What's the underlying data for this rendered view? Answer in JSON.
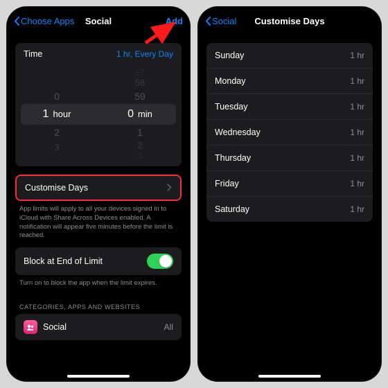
{
  "left": {
    "nav_back": "Choose Apps",
    "nav_title": "Social",
    "nav_add": "Add",
    "time_label": "Time",
    "time_value": "1 hr, Every Day",
    "picker": {
      "hours_above2": "",
      "hours_above": "0",
      "hours_sel": "1",
      "hours_unit": "hour",
      "hours_below": "2",
      "hours_below2": "3",
      "mins_top2": "57",
      "mins_top1": "58",
      "mins_above": "59",
      "mins_sel": "0",
      "mins_unit": "min",
      "mins_below": "1",
      "mins_below2": "2",
      "mins_below3": "3"
    },
    "customise_label": "Customise Days",
    "footnote": "App limits will apply to all your devices signed in to iCloud with Share Across Devices enabled. A notification will appear five minutes before the limit is reached.",
    "block_label": "Block at End of Limit",
    "block_caption": "Turn on to block the app when the limit expires.",
    "section_header": "CATEGORIES, APPS AND WEBSITES",
    "category_name": "Social",
    "category_scope": "All"
  },
  "right": {
    "nav_back": "Social",
    "nav_title": "Customise Days",
    "days": [
      {
        "name": "Sunday",
        "value": "1 hr"
      },
      {
        "name": "Monday",
        "value": "1 hr"
      },
      {
        "name": "Tuesday",
        "value": "1 hr"
      },
      {
        "name": "Wednesday",
        "value": "1 hr"
      },
      {
        "name": "Thursday",
        "value": "1 hr"
      },
      {
        "name": "Friday",
        "value": "1 hr"
      },
      {
        "name": "Saturday",
        "value": "1 hr"
      }
    ]
  }
}
